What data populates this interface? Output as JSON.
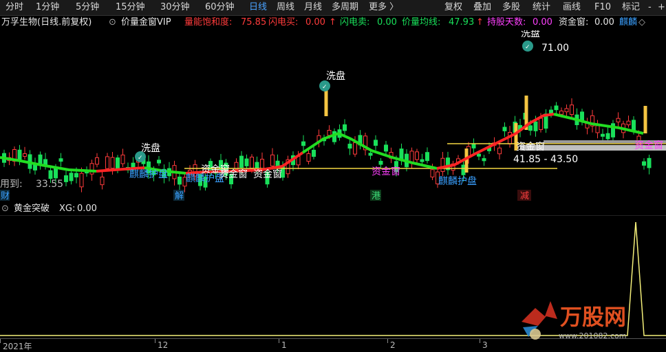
{
  "toolbar": {
    "periods": [
      "分时",
      "1分钟",
      "5分钟",
      "15分钟",
      "30分钟",
      "60分钟",
      "日线",
      "周线",
      "月线",
      "多周期",
      "更多 〉"
    ],
    "active_period": "日线",
    "right_buttons": [
      "复权",
      "叠加",
      "多股",
      "统计",
      "画线",
      "F10",
      "标记",
      "-",
      "+"
    ]
  },
  "info": {
    "stock": "万孚生物(日线.前复权)",
    "indicator": "价量金窗VIP",
    "saturation_label": "量能饱和度:",
    "saturation_value": "75.85",
    "flash_buy_label": "闪电买:",
    "flash_buy_value": "0.00",
    "flash_sell_label": "闪电卖:",
    "flash_sell_value": "0.00",
    "vol_ma_label": "价量均线:",
    "vol_ma_value": "47.93",
    "hold_days_label": "持股天数:",
    "hold_days_value": "0.00",
    "capital_window_label": "资金窗:",
    "capital_window_value": "0.00",
    "truncated_label": "麒麟"
  },
  "annotations": {
    "wash1": "洗盘",
    "wash2": "洗盘",
    "wash3": "洗盘",
    "high_price": "71.00",
    "low_price": "33.55",
    "low_prefix": "用到:",
    "guard1": "麒麟护盘",
    "guard2": "麒麟护盘",
    "guard3": "麒麟护盘",
    "fund_windows": [
      "资金窗",
      "资金窗",
      "资金窗",
      "资金窗"
    ],
    "fund_window_right": "资金窗",
    "fund_window_far": "资金窗",
    "price_range": "41.85 - 43.50",
    "magenta_window": "资金窗",
    "marker_cai": "财",
    "marker_jie": "解",
    "marker_gang": "港",
    "marker_jian": "减"
  },
  "sub": {
    "title": "黄金突破",
    "xg_label": "XG:",
    "xg_value": "0.00"
  },
  "dates": [
    "2021年",
    "12",
    "1",
    "2",
    "3"
  ],
  "watermark": {
    "brand": "万股网",
    "url": "www.201082.com"
  },
  "colors": {
    "up": "#ff3b3b",
    "down": "#19e05a",
    "ma_up": "#ff2424",
    "ma_down": "#22dd22",
    "yellow": "#f5d742",
    "magenta": "#ff40ff",
    "blue_text": "#3aa0ff"
  }
}
